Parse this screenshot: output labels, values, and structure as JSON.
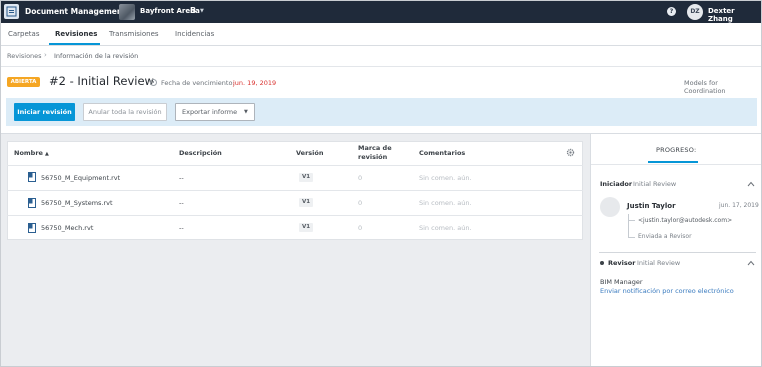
{
  "topbar": {
    "app_name": "Document Management",
    "project_name": "Bayfront Arena",
    "project_badge": "B",
    "help_icon": "help-icon",
    "user_initials": "DZ",
    "user_name": "Dexter Zhang"
  },
  "tabs": [
    {
      "label": "Carpetas",
      "active": false
    },
    {
      "label": "Revisiones",
      "active": true
    },
    {
      "label": "Transmisiones",
      "active": false
    },
    {
      "label": "Incidencias",
      "active": false
    }
  ],
  "breadcrumb": {
    "root": "Revisiones",
    "current": "Información de la revisión"
  },
  "review": {
    "status": "ABIERTA",
    "title": "#2 - Initial Review",
    "due_label": "Fecha de vencimiento:",
    "due_date": "jun. 19, 2019",
    "models_link": "Models for Coordination"
  },
  "actions": {
    "start": "Iniciar revisión",
    "void": "Anular toda la revisión",
    "export": "Exportar informe"
  },
  "table": {
    "headers": {
      "name": "Nombre",
      "description": "Descripción",
      "version": "Versión",
      "markup": "Marca de revisión",
      "comments": "Comentarios"
    },
    "rows": [
      {
        "name": "56750_M_Equipment.rvt",
        "description": "--",
        "version": "V1",
        "markup": "0",
        "comments": "Sin comen. aún."
      },
      {
        "name": "56750_M_Systems.rvt",
        "description": "--",
        "version": "V1",
        "markup": "0",
        "comments": "Sin comen. aún."
      },
      {
        "name": "56750_Mech.rvt",
        "description": "--",
        "version": "V1",
        "markup": "0",
        "comments": "Sin comen. aún."
      }
    ]
  },
  "progress_panel": {
    "tab_label": "PROGRESO:",
    "initiator": {
      "label": "Iniciador",
      "step": "Initial Review",
      "person_name": "Justin Taylor",
      "date": "jun. 17, 2019",
      "email": "<justin.taylor@autodesk.com>",
      "status": "Enviada a Revisor"
    },
    "reviewer": {
      "label": "Revisor",
      "step": "Initial Review",
      "role": "BIM Manager",
      "notify_link": "Enviar notificación por correo electrónico"
    }
  },
  "colors": {
    "topbar": "#1f2a3a",
    "accent": "#0696d7",
    "badge_open": "#f5a623",
    "due_date": "#d9322f",
    "action_bar": "#dcecf7"
  }
}
